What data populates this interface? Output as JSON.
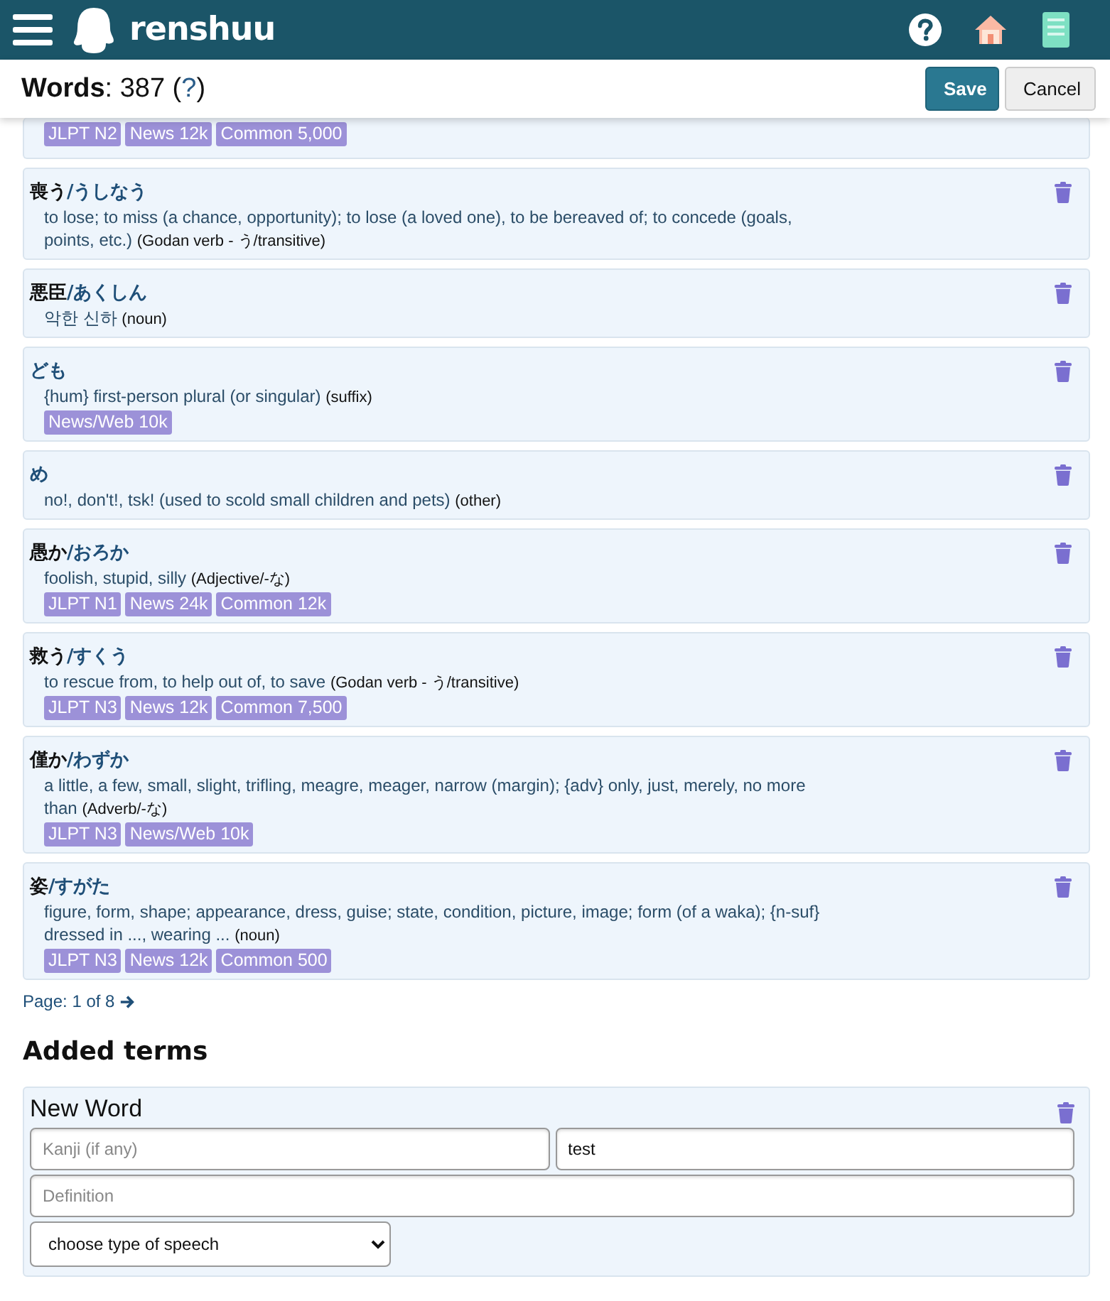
{
  "app": {
    "name": "renshuu"
  },
  "toolbar": {
    "heading": "**Words**: 387 (",
    "help_link": "?",
    "heading_end": ")",
    "buttons": [
      {
        "label": "Save",
        "kind": "primary"
      },
      {
        "label": "Cancel",
        "kind": "secondary"
      }
    ]
  },
  "words": [
    {
      "tags": [
        "JLPT N2",
        "News 12k",
        "Common 5,000"
      ]
    },
    {
      "kanji": "喪う",
      "reading": "/うしなう",
      "definition": "to lose; to miss (a chance, opportunity); to lose (a loved one), to be bereaved of; to concede (goals, points, etc.)",
      "pos": "(Godan verb - う/transitive)"
    },
    {
      "kanji": "悪臣",
      "reading": "/あくしん",
      "definition": "악한 신하",
      "pos": "(noun)"
    },
    {
      "reading": "ども",
      "definition": "{hum} first-person plural (or singular)",
      "pos": "(suffix)",
      "tags": [
        "News/Web 10k"
      ]
    },
    {
      "reading": "め",
      "definition": "no!, don't!, tsk! (used to scold small children and pets)",
      "pos": "(other)"
    },
    {
      "kanji": "愚か",
      "reading": "/おろか",
      "definition": "foolish, stupid, silly",
      "pos": "(Adjective/-な)",
      "tags": [
        "JLPT N1",
        "News 24k",
        "Common 12k"
      ]
    },
    {
      "kanji": "救う",
      "reading": "/すくう",
      "definition": "to rescue from, to help out of, to save",
      "pos": "(Godan verb - う/transitive)",
      "tags": [
        "JLPT N3",
        "News 12k",
        "Common 7,500"
      ]
    },
    {
      "kanji": "僅か",
      "reading": "/わずか",
      "definition": "a little, a few, small, slight, trifling, meagre, meager, narrow (margin); {adv} only, just, merely, no more than",
      "pos": "(Adverb/-な)",
      "tags": [
        "JLPT N3",
        "News/Web 10k"
      ]
    },
    {
      "kanji": "姿",
      "reading": "/すがた",
      "definition": "figure, form, shape; appearance, dress, guise; state, condition, picture, image; form (of a waka); {n-suf} dressed in ..., wearing ...",
      "pos": "(noun)",
      "tags": [
        "JLPT N3",
        "News 12k",
        "Common 500"
      ]
    }
  ],
  "pagination": {
    "label": "Page: 1 of 8"
  },
  "added_terms": {
    "heading": "Added terms",
    "card_title": "New Word",
    "kanji_field": {
      "placeholder": "Kanji (if any)"
    },
    "reading_field": {
      "value": "test"
    },
    "definition_field": {
      "placeholder": "Definition"
    },
    "type_select": {
      "value": "choose type of speech"
    }
  }
}
